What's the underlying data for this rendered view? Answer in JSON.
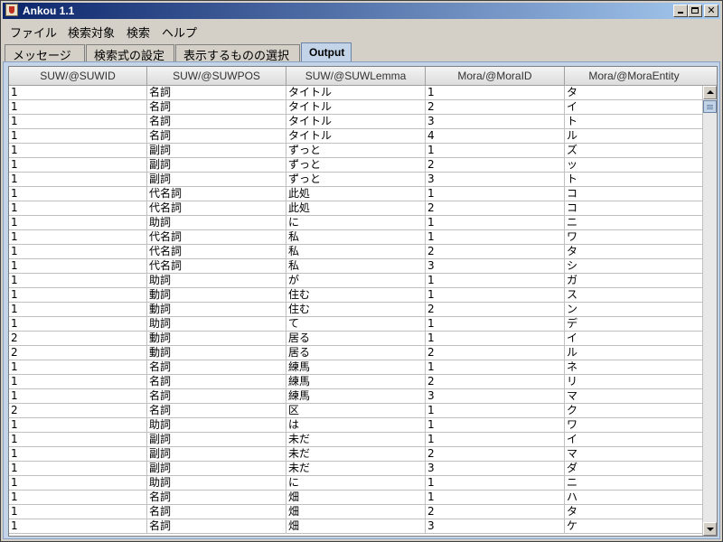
{
  "window": {
    "title": "Ankou 1.1"
  },
  "menubar": {
    "items": [
      "ファイル",
      "検索対象",
      "検索",
      "ヘルプ"
    ]
  },
  "tabs": [
    "メッセージ",
    "検索式の設定",
    "表示するものの選択",
    "Output"
  ],
  "table": {
    "columns": [
      "SUW/@SUWID",
      "SUW/@SUWPOS",
      "SUW/@SUWLemma",
      "Mora/@MoraID",
      "Mora/@MoraEntity"
    ],
    "rows": [
      [
        "1",
        "名詞",
        "タイトル",
        "1",
        "タ"
      ],
      [
        "1",
        "名詞",
        "タイトル",
        "2",
        "イ"
      ],
      [
        "1",
        "名詞",
        "タイトル",
        "3",
        "ト"
      ],
      [
        "1",
        "名詞",
        "タイトル",
        "4",
        "ル"
      ],
      [
        "1",
        "副詞",
        "ずっと",
        "1",
        "ズ"
      ],
      [
        "1",
        "副詞",
        "ずっと",
        "2",
        "ッ"
      ],
      [
        "1",
        "副詞",
        "ずっと",
        "3",
        "ト"
      ],
      [
        "1",
        "代名詞",
        "此処",
        "1",
        "コ"
      ],
      [
        "1",
        "代名詞",
        "此処",
        "2",
        "コ"
      ],
      [
        "1",
        "助詞",
        "に",
        "1",
        "ニ"
      ],
      [
        "1",
        "代名詞",
        "私",
        "1",
        "ワ"
      ],
      [
        "1",
        "代名詞",
        "私",
        "2",
        "タ"
      ],
      [
        "1",
        "代名詞",
        "私",
        "3",
        "シ"
      ],
      [
        "1",
        "助詞",
        "が",
        "1",
        "ガ"
      ],
      [
        "1",
        "動詞",
        "住む",
        "1",
        "ス"
      ],
      [
        "1",
        "動詞",
        "住む",
        "2",
        "ン"
      ],
      [
        "1",
        "助詞",
        "て",
        "1",
        "デ"
      ],
      [
        "2",
        "動詞",
        "居る",
        "1",
        "イ"
      ],
      [
        "2",
        "動詞",
        "居る",
        "2",
        "ル"
      ],
      [
        "1",
        "名詞",
        "練馬",
        "1",
        "ネ"
      ],
      [
        "1",
        "名詞",
        "練馬",
        "2",
        "リ"
      ],
      [
        "1",
        "名詞",
        "練馬",
        "3",
        "マ"
      ],
      [
        "2",
        "名詞",
        "区",
        "1",
        "ク"
      ],
      [
        "1",
        "助詞",
        "は",
        "1",
        "ワ"
      ],
      [
        "1",
        "副詞",
        "未だ",
        "1",
        "イ"
      ],
      [
        "1",
        "副詞",
        "未だ",
        "2",
        "マ"
      ],
      [
        "1",
        "副詞",
        "未だ",
        "3",
        "ダ"
      ],
      [
        "1",
        "助詞",
        "に",
        "1",
        "ニ"
      ],
      [
        "1",
        "名詞",
        "畑",
        "1",
        "ハ"
      ],
      [
        "1",
        "名詞",
        "畑",
        "2",
        "タ"
      ],
      [
        "1",
        "名詞",
        "畑",
        "3",
        "ケ"
      ]
    ]
  }
}
